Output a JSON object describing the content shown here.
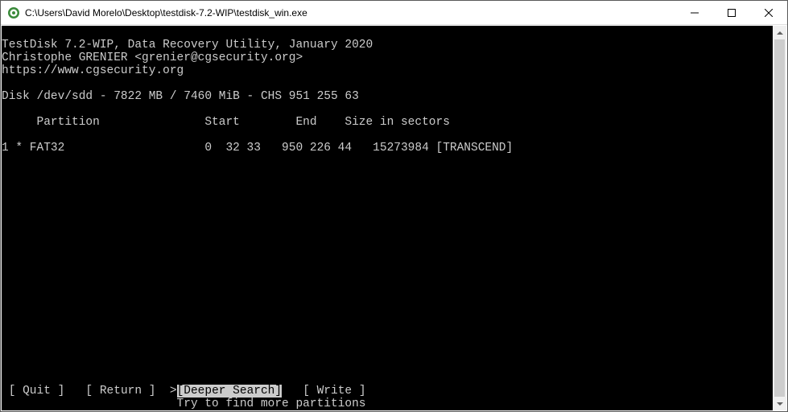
{
  "window": {
    "title": "C:\\Users\\David Morelo\\Desktop\\testdisk-7.2-WIP\\testdisk_win.exe"
  },
  "app": {
    "name_line": "TestDisk 7.2-WIP, Data Recovery Utility, January 2020",
    "author_line": "Christophe GRENIER <grenier@cgsecurity.org>",
    "url_line": "https://www.cgsecurity.org"
  },
  "disk": {
    "line": "Disk /dev/sdd - 7822 MB / 7460 MiB - CHS 951 255 63"
  },
  "table": {
    "header": "     Partition               Start        End    Size in sectors",
    "rows": [
      "1 * FAT32                    0  32 33   950 226 44   15273984 [TRANSCEND]"
    ]
  },
  "menu": {
    "items": [
      {
        "label": "Quit",
        "selected": false
      },
      {
        "label": "Return",
        "selected": false
      },
      {
        "label": "Deeper Search",
        "selected": true
      },
      {
        "label": "Write",
        "selected": false
      }
    ],
    "hint": "                         Try to find more partitions"
  }
}
